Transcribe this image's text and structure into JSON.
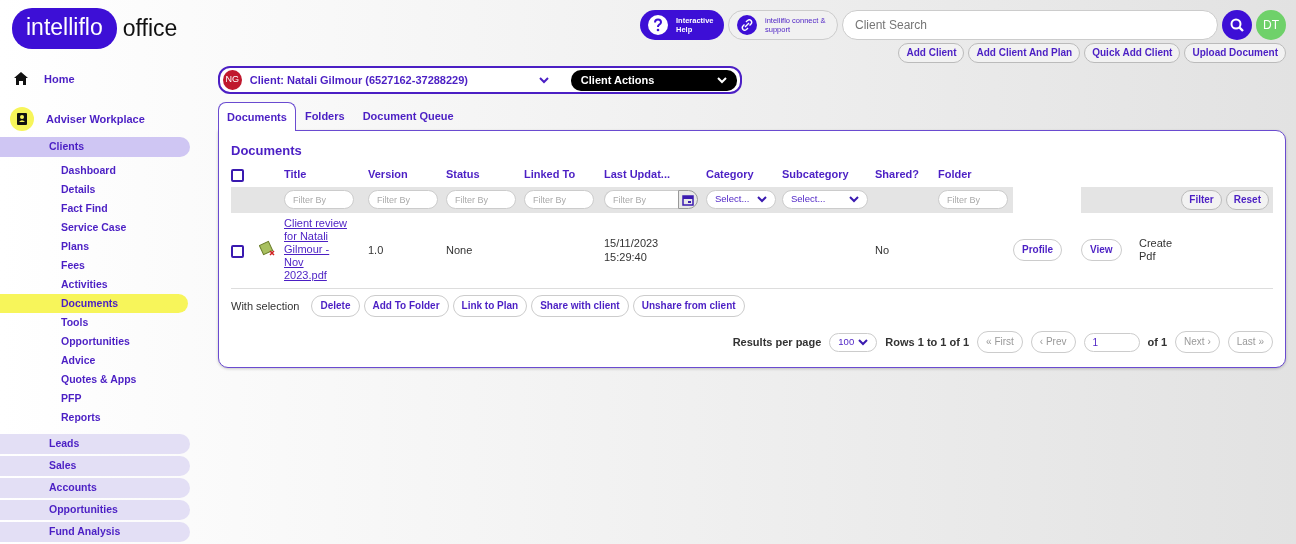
{
  "logo": {
    "badge": "intelliflo",
    "text": "office"
  },
  "header": {
    "help": "Interactive Help",
    "connect": "intelliflo connect & support",
    "search": {
      "placeholder": "Client Search"
    },
    "avatar": "DT"
  },
  "quick_actions": [
    "Add Client",
    "Add Client And Plan",
    "Quick Add Client",
    "Upload Document"
  ],
  "sidebar": {
    "home": "Home",
    "workplace": "Adviser Workplace",
    "sections": [
      {
        "label": "Clients",
        "expanded": true,
        "children": [
          {
            "label": "Dashboard",
            "selected": false
          },
          {
            "label": "Details",
            "selected": false
          },
          {
            "label": "Fact Find",
            "selected": false
          },
          {
            "label": "Service Case",
            "selected": false
          },
          {
            "label": "Plans",
            "selected": false
          },
          {
            "label": "Fees",
            "selected": false
          },
          {
            "label": "Activities",
            "selected": false
          },
          {
            "label": "Documents",
            "selected": true
          },
          {
            "label": "Tools",
            "selected": false
          },
          {
            "label": "Opportunities",
            "selected": false
          },
          {
            "label": "Advice",
            "selected": false
          },
          {
            "label": "Quotes & Apps",
            "selected": false
          },
          {
            "label": "PFP",
            "selected": false
          },
          {
            "label": "Reports",
            "selected": false
          }
        ]
      },
      {
        "label": "Leads",
        "expanded": false
      },
      {
        "label": "Sales",
        "expanded": false
      },
      {
        "label": "Accounts",
        "expanded": false
      },
      {
        "label": "Opportunities",
        "expanded": false
      },
      {
        "label": "Fund Analysis",
        "expanded": false
      }
    ]
  },
  "client": {
    "initials": "NG",
    "label": "Client: Natali Gilmour (6527162-37288229)",
    "actions": "Client Actions"
  },
  "tabs": [
    {
      "label": "Documents",
      "selected": true
    },
    {
      "label": "Folders",
      "selected": false
    },
    {
      "label": "Document Queue",
      "selected": false
    }
  ],
  "panel": {
    "title": "Documents",
    "all_checked": false,
    "columns": [
      "Title",
      "Version",
      "Status",
      "Linked To",
      "Last Updat...",
      "Category",
      "Subcategory",
      "Shared?",
      "Folder"
    ],
    "filters": [
      {
        "kind": "text",
        "placeholder": "Filter By"
      },
      {
        "kind": "text",
        "placeholder": "Filter By"
      },
      {
        "kind": "text",
        "placeholder": "Filter By"
      },
      {
        "kind": "text",
        "placeholder": "Filter By"
      },
      {
        "kind": "date",
        "placeholder": "Filter By"
      },
      {
        "kind": "select",
        "value": "Select..."
      },
      {
        "kind": "select",
        "value": "Select..."
      },
      {
        "kind": "none"
      },
      {
        "kind": "text",
        "placeholder": "Filter By"
      }
    ],
    "filter_buttons": [
      "Filter",
      "Reset"
    ],
    "rows": [
      {
        "checked": false,
        "cells": [
          "Client review for Natali Gilmour - Nov 2023.pdf",
          "1.0",
          "None",
          null,
          "15/11/2023 15:29:40",
          null,
          null,
          "No",
          null
        ],
        "buttons": [
          "Profile",
          "View"
        ],
        "extra": "Create Pdf"
      }
    ],
    "selection_label": "With selection",
    "selection_buttons": [
      "Delete",
      "Add To Folder",
      "Link to Plan",
      "Share with client",
      "Unshare from client"
    ],
    "pagination": {
      "results_label": "Results per page",
      "per_page": "100",
      "rows_text": "Rows 1 to 1 of 1",
      "page": "1",
      "of": "of 1",
      "buttons": [
        {
          "label": "« First",
          "disabled": true
        },
        {
          "label": "‹ Prev",
          "disabled": true
        },
        {
          "label": "Next ›",
          "disabled": true
        },
        {
          "label": "Last »",
          "disabled": true
        }
      ]
    }
  }
}
